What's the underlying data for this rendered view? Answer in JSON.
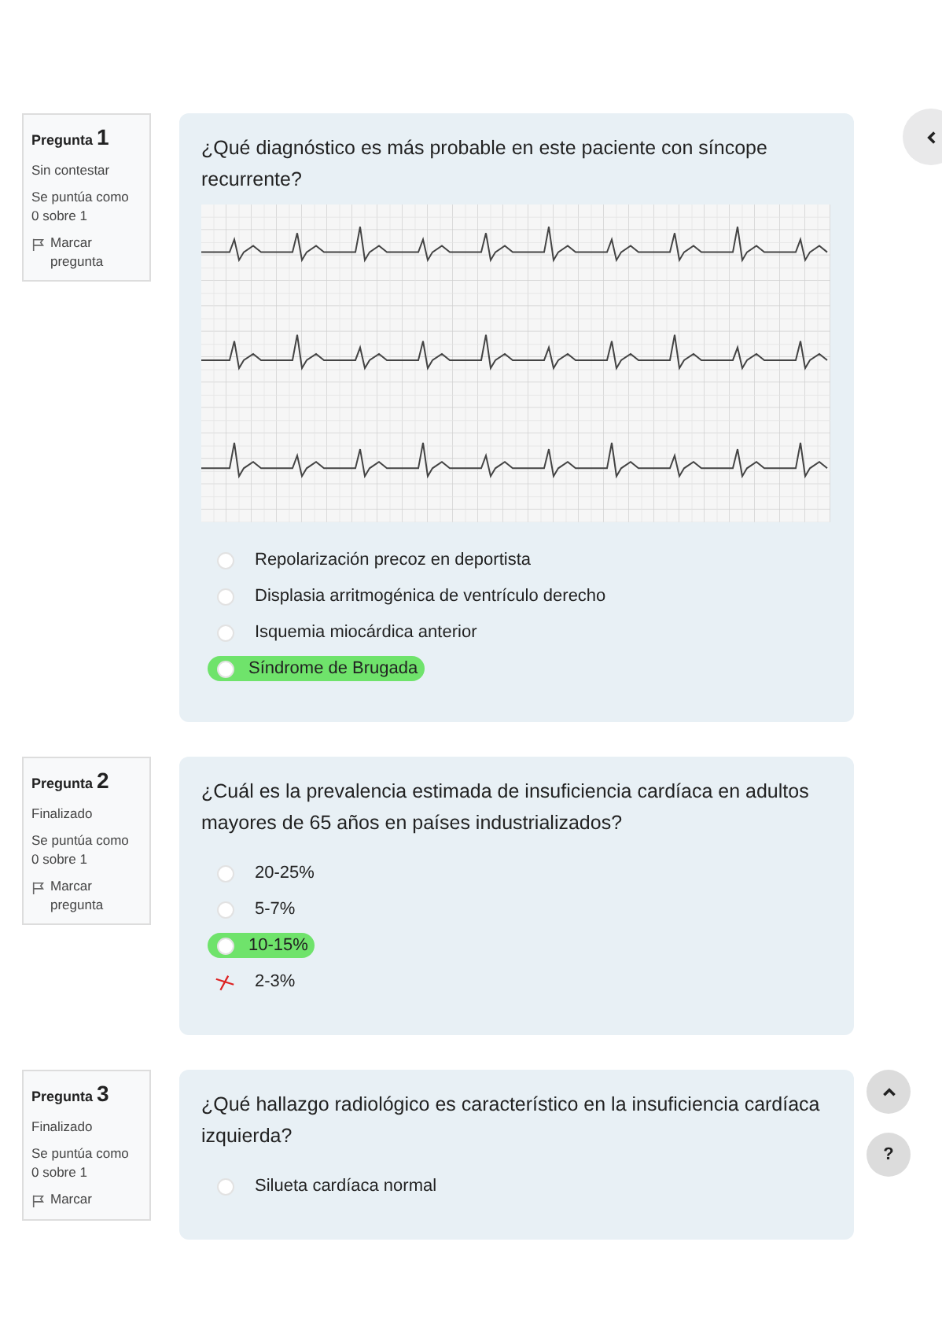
{
  "questions": [
    {
      "label": "Pregunta",
      "number": "1",
      "status": "Sin contestar",
      "score": "Se puntúa como 0 sobre 1",
      "flag": "Marcar pregunta",
      "text": "¿Qué diagnóstico es más probable en este paciente con síncope recurrente?",
      "answers": [
        {
          "text": "Repolarización precoz en deportista",
          "checked": false,
          "highlighted": false,
          "crossed": false
        },
        {
          "text": "Displasia arritmogénica de ventrículo derecho",
          "checked": false,
          "highlighted": false,
          "crossed": false
        },
        {
          "text": "Isquemia miocárdica anterior",
          "checked": false,
          "highlighted": false,
          "crossed": false
        },
        {
          "text": "Síndrome de Brugada",
          "checked": false,
          "highlighted": true,
          "crossed": false
        }
      ]
    },
    {
      "label": "Pregunta",
      "number": "2",
      "status": "Finalizado",
      "score": "Se puntúa como 0 sobre 1",
      "flag": "Marcar pregunta",
      "text": "¿Cuál es la prevalencia estimada de insuficiencia cardíaca en adultos mayores de 65 años en países industrializados?",
      "answers": [
        {
          "text": "20-25%",
          "checked": false,
          "highlighted": false,
          "crossed": false
        },
        {
          "text": "5-7%",
          "checked": false,
          "highlighted": false,
          "crossed": false
        },
        {
          "text": "10-15%",
          "checked": false,
          "highlighted": true,
          "crossed": false
        },
        {
          "text": "2-3%",
          "highlighted": false,
          "crossed": true
        }
      ]
    },
    {
      "label": "Pregunta",
      "number": "3",
      "status": "Finalizado",
      "score": "Se puntúa como 0 sobre 1",
      "flag": "Marcar",
      "text": "¿Qué hallazgo radiológico es característico en la insuficiencia cardíaca izquierda?",
      "answers": [
        {
          "text": "Silueta cardíaca normal",
          "checked": false,
          "highlighted": false,
          "crossed": false
        }
      ]
    }
  ],
  "side_buttons": [
    {
      "kind": "back"
    },
    {
      "kind": "up"
    },
    {
      "kind": "help",
      "text": "?"
    }
  ]
}
